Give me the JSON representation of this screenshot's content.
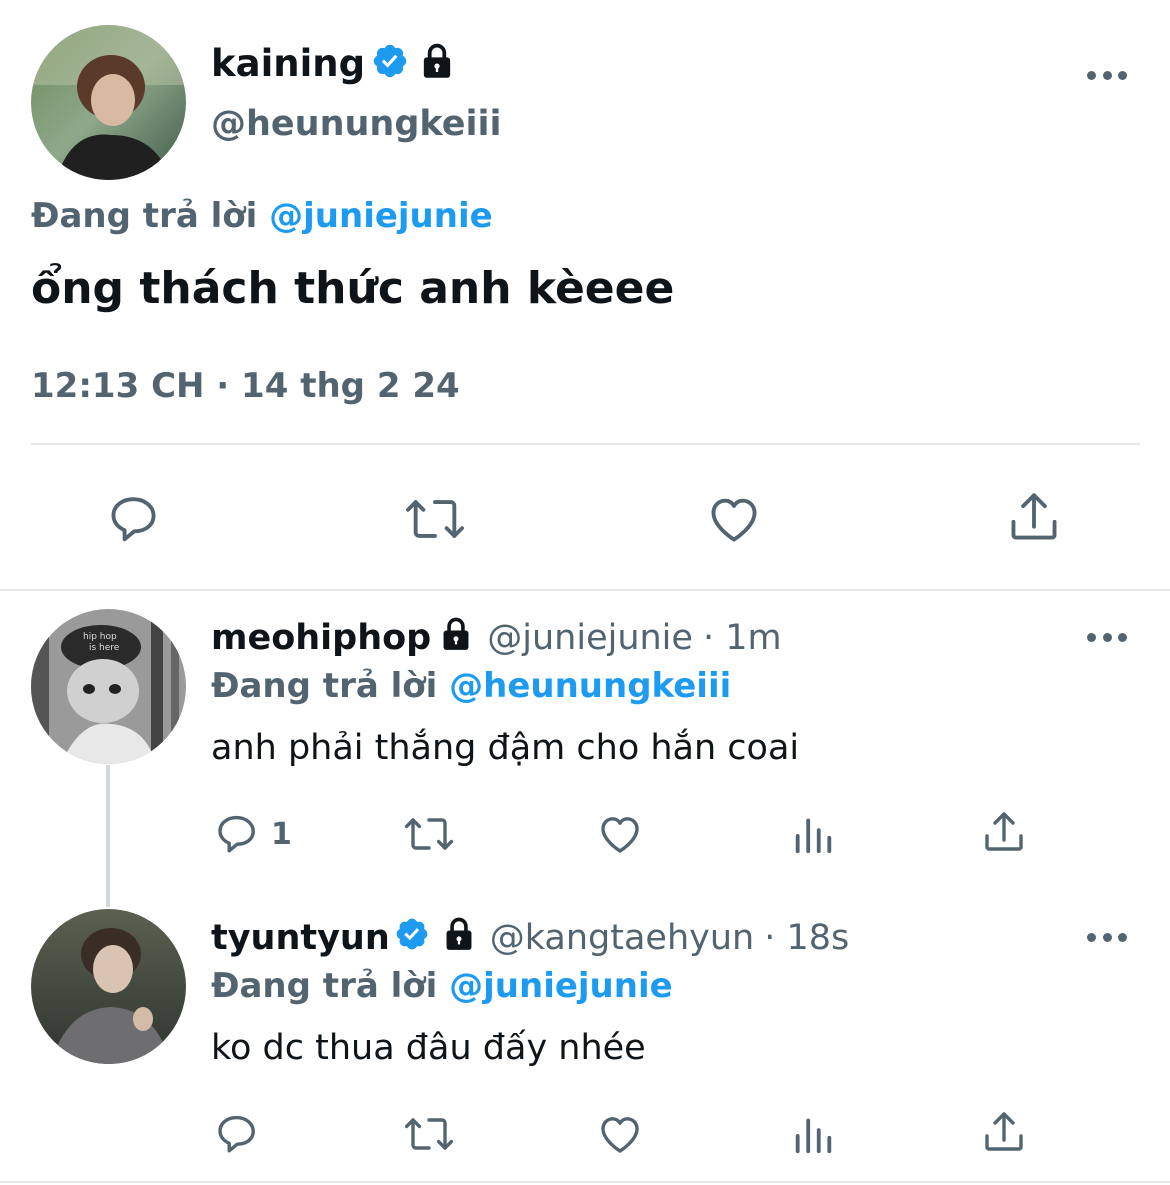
{
  "main_tweet": {
    "display_name": "kaining",
    "handle": "@heunungkeiii",
    "replying_prefix": "Đang trả lời",
    "replying_to": "@juniejunie",
    "text": "ổng thách thức anh kèeee",
    "timestamp": "12:13 CH · 14 thg 2 24"
  },
  "replies": [
    {
      "display_name": "meohiphop",
      "handle": "@juniejunie",
      "time": "· 1m",
      "replying_prefix": "Đang trả lời",
      "replying_to": "@heunungkeiii",
      "text": "anh phải thắng đậm cho hắn coai",
      "reply_count": "1",
      "avatar_text": "hip hop is here"
    },
    {
      "display_name": "tyuntyun",
      "handle": "@kangtaehyun",
      "time": "· 18s",
      "replying_prefix": "Đang trả lời",
      "replying_to": "@juniejunie",
      "text": "ko dc thua đâu đấy nhée"
    }
  ],
  "colors": {
    "accent": "#1d9bf0",
    "text_primary": "#0f1419",
    "text_secondary": "#536471",
    "divider": "#e6e9ec"
  },
  "icons": [
    "verified-badge-icon",
    "lock-icon",
    "more-icon",
    "reply-icon",
    "retweet-icon",
    "like-icon",
    "share-icon",
    "views-icon"
  ]
}
